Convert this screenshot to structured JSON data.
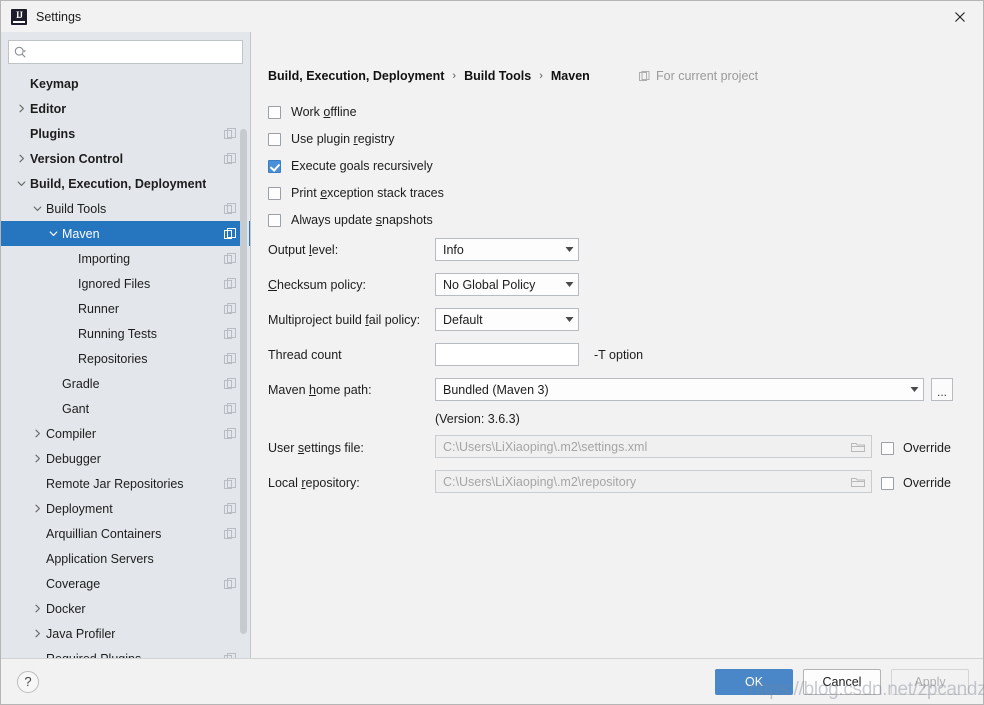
{
  "window": {
    "title": "Settings",
    "logo_icon": "intellij-idea-logo",
    "close_icon": "close-icon"
  },
  "search": {
    "value": "",
    "placeholder": "",
    "icon": "search-icon",
    "dropdown_icon": "chevron-down-icon"
  },
  "sidebar": {
    "copy_icon": "copy-icon",
    "items": [
      {
        "label": "Keymap",
        "indent": 0,
        "chevron": "none",
        "bold": true,
        "copy": false,
        "selected": false
      },
      {
        "label": "Editor",
        "indent": 0,
        "chevron": "right",
        "bold": true,
        "copy": false,
        "selected": false
      },
      {
        "label": "Plugins",
        "indent": 0,
        "chevron": "none",
        "bold": true,
        "copy": true,
        "selected": false
      },
      {
        "label": "Version Control",
        "indent": 0,
        "chevron": "right",
        "bold": true,
        "copy": true,
        "selected": false
      },
      {
        "label": "Build, Execution, Deployment",
        "indent": 0,
        "chevron": "down",
        "bold": true,
        "copy": false,
        "selected": false
      },
      {
        "label": "Build Tools",
        "indent": 1,
        "chevron": "down",
        "bold": false,
        "copy": true,
        "selected": false
      },
      {
        "label": "Maven",
        "indent": 2,
        "chevron": "down",
        "bold": false,
        "copy": true,
        "selected": true
      },
      {
        "label": "Importing",
        "indent": 3,
        "chevron": "none",
        "bold": false,
        "copy": true,
        "selected": false
      },
      {
        "label": "Ignored Files",
        "indent": 3,
        "chevron": "none",
        "bold": false,
        "copy": true,
        "selected": false
      },
      {
        "label": "Runner",
        "indent": 3,
        "chevron": "none",
        "bold": false,
        "copy": true,
        "selected": false
      },
      {
        "label": "Running Tests",
        "indent": 3,
        "chevron": "none",
        "bold": false,
        "copy": true,
        "selected": false
      },
      {
        "label": "Repositories",
        "indent": 3,
        "chevron": "none",
        "bold": false,
        "copy": true,
        "selected": false
      },
      {
        "label": "Gradle",
        "indent": 2,
        "chevron": "none",
        "bold": false,
        "copy": true,
        "selected": false
      },
      {
        "label": "Gant",
        "indent": 2,
        "chevron": "none",
        "bold": false,
        "copy": true,
        "selected": false
      },
      {
        "label": "Compiler",
        "indent": 1,
        "chevron": "right",
        "bold": false,
        "copy": true,
        "selected": false
      },
      {
        "label": "Debugger",
        "indent": 1,
        "chevron": "right",
        "bold": false,
        "copy": false,
        "selected": false
      },
      {
        "label": "Remote Jar Repositories",
        "indent": 1,
        "chevron": "none",
        "bold": false,
        "copy": true,
        "selected": false
      },
      {
        "label": "Deployment",
        "indent": 1,
        "chevron": "right",
        "bold": false,
        "copy": true,
        "selected": false
      },
      {
        "label": "Arquillian Containers",
        "indent": 1,
        "chevron": "none",
        "bold": false,
        "copy": true,
        "selected": false
      },
      {
        "label": "Application Servers",
        "indent": 1,
        "chevron": "none",
        "bold": false,
        "copy": false,
        "selected": false
      },
      {
        "label": "Coverage",
        "indent": 1,
        "chevron": "none",
        "bold": false,
        "copy": true,
        "selected": false
      },
      {
        "label": "Docker",
        "indent": 1,
        "chevron": "right",
        "bold": false,
        "copy": false,
        "selected": false
      },
      {
        "label": "Java Profiler",
        "indent": 1,
        "chevron": "right",
        "bold": false,
        "copy": false,
        "selected": false
      },
      {
        "label": "Required Plugins",
        "indent": 1,
        "chevron": "none",
        "bold": false,
        "copy": true,
        "selected": false
      }
    ]
  },
  "main": {
    "breadcrumb": [
      "Build, Execution, Deployment",
      "Build Tools",
      "Maven"
    ],
    "breadcrumb_separator": "›",
    "scope_note": "For current project",
    "scope_icon": "project-icon",
    "checkboxes": [
      {
        "label_pre": "Work ",
        "mnemonic": "o",
        "label_post": "ffline",
        "checked": false
      },
      {
        "label_pre": "Use plugin ",
        "mnemonic": "r",
        "label_post": "egistry",
        "checked": false
      },
      {
        "label_pre": "Execute ",
        "mnemonic": "g",
        "label_post": "oals recursively",
        "checked": true
      },
      {
        "label_pre": "Print ",
        "mnemonic": "e",
        "label_post": "xception stack traces",
        "checked": false
      },
      {
        "label_pre": "Always update ",
        "mnemonic": "s",
        "label_post": "napshots",
        "checked": false
      }
    ],
    "output_level": {
      "label_pre": "Output ",
      "mnemonic": "l",
      "label_post": "evel:",
      "value": "Info",
      "arrow_icon": "chevron-down-icon"
    },
    "checksum_policy": {
      "label_pre": "",
      "mnemonic": "C",
      "label_post": "hecksum policy:",
      "value": "No Global Policy",
      "arrow_icon": "chevron-down-icon"
    },
    "fail_policy": {
      "label_pre": "Multiproject build ",
      "mnemonic": "f",
      "label_post": "ail policy:",
      "value": "Default",
      "arrow_icon": "chevron-down-icon"
    },
    "thread_count": {
      "label": "Thread count",
      "value": "",
      "hint": "-T option"
    },
    "maven_home": {
      "label_pre": "Maven ",
      "mnemonic": "h",
      "label_post": "ome path:",
      "value": "Bundled (Maven 3)",
      "version_note": "(Version: 3.6.3)",
      "arrow_icon": "chevron-down-icon",
      "browse_label": "..."
    },
    "user_settings": {
      "label_pre": "User ",
      "mnemonic": "s",
      "label_post": "ettings file:",
      "value": "C:\\Users\\LiXiaoping\\.m2\\settings.xml",
      "folder_icon": "folder-icon",
      "override_label": "Override",
      "override_checked": false
    },
    "local_repository": {
      "label_pre": "Local ",
      "mnemonic": "r",
      "label_post": "epository:",
      "value": "C:\\Users\\LiXiaoping\\.m2\\repository",
      "folder_icon": "folder-icon",
      "override_label": "Override",
      "override_checked": false
    }
  },
  "footer": {
    "help_label": "?",
    "help_icon": "help-icon",
    "ok_label": "OK",
    "cancel_label": "Cancel",
    "apply_label": "Apply"
  },
  "watermark": {
    "text": "https://blog.csdn.net/zpcandzhj"
  },
  "colors": {
    "selection": "#2675bf",
    "accent": "#4a90d9",
    "primary_button": "#4a87c8",
    "sidebar_bg": "#e3e7eb",
    "panel_bg": "#f2f2f2"
  }
}
